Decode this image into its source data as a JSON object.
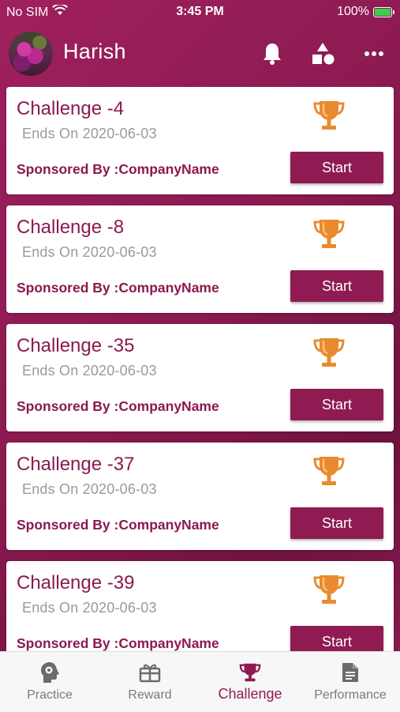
{
  "status_bar": {
    "carrier": "No SIM",
    "time": "3:45 PM",
    "battery": "100%"
  },
  "header": {
    "user_name": "Harish",
    "icons": [
      "bell-icon",
      "shapes-icon",
      "more-icon"
    ]
  },
  "challenges": [
    {
      "title": "Challenge -4",
      "ends": "Ends On 2020-06-03",
      "sponsor": "Sponsored By :CompanyName",
      "button": "Start"
    },
    {
      "title": "Challenge -8",
      "ends": "Ends On 2020-06-03",
      "sponsor": "Sponsored By :CompanyName",
      "button": "Start"
    },
    {
      "title": "Challenge -35",
      "ends": "Ends On 2020-06-03",
      "sponsor": "Sponsored By :CompanyName",
      "button": "Start"
    },
    {
      "title": "Challenge -37",
      "ends": "Ends On 2020-06-03",
      "sponsor": "Sponsored By :CompanyName",
      "button": "Start"
    },
    {
      "title": "Challenge -39",
      "ends": "Ends On 2020-06-03",
      "sponsor": "Sponsored By :CompanyName",
      "button": "Start"
    }
  ],
  "bottom_nav": [
    {
      "label": "Practice",
      "icon": "brain-gear-icon",
      "active": false
    },
    {
      "label": "Reward",
      "icon": "gift-icon",
      "active": false
    },
    {
      "label": "Challenge",
      "icon": "trophy-icon",
      "active": true
    },
    {
      "label": "Performance",
      "icon": "document-icon",
      "active": false
    }
  ],
  "colors": {
    "primary": "#8f1b52",
    "trophy": "#e98a2f",
    "nav_inactive": "#7b7b7b"
  }
}
